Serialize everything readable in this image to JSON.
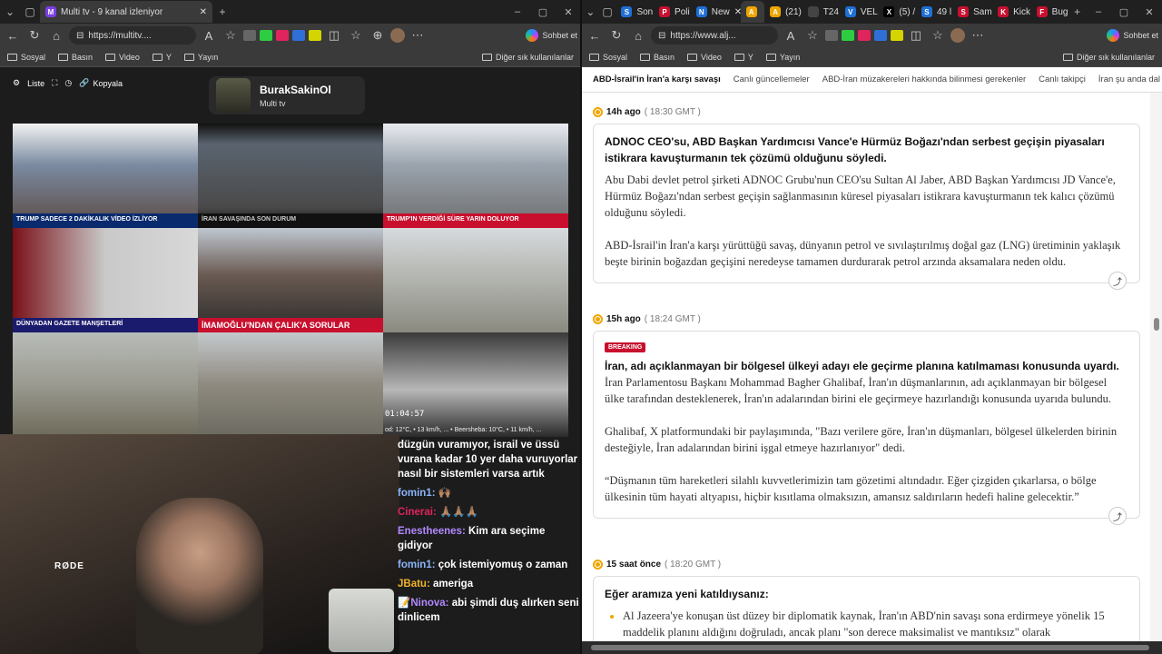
{
  "left": {
    "tab_title": "Multi tv - 9 kanal izleniyor",
    "url": "https://multitv....",
    "chat_button": "Sohbet et",
    "bookmarks": [
      "Sosyal",
      "Basın",
      "Video",
      "Y",
      "Yayın"
    ],
    "bookmarks_other": "Diğer sık kullanılanlar",
    "toolbar": {
      "list": "Liste",
      "copy": "Kopyala"
    },
    "channel": {
      "name": "BurakSakinOl",
      "subtitle": "Multi tv"
    },
    "tiles": [
      {
        "ticker": "TRUMP SADECE 2 DAKİKALIK VİDEO İZLİYOR"
      },
      {
        "ticker": "İRAN SAVAŞINDA SON DURUM"
      },
      {
        "ticker": "TRUMP'IN VERDİĞİ SÜRE YARIN DOLUYOR"
      },
      {
        "ticker": "DÜNYADAN GAZETE MANŞETLERİ"
      },
      {
        "ticker": "İMAMOĞLU'NDAN ÇALIK'A SORULAR"
      },
      {
        "ticker": ""
      },
      {
        "ticker": ""
      },
      {
        "ticker": ""
      },
      {
        "ticker": "",
        "clock": "01:04:57",
        "weather": "od: 12°C, • 13 km/h, ... • Beersheba: 10°C, • 11 km/h, ..."
      }
    ],
    "cam_label": "RØDE",
    "chat": [
      {
        "user": "",
        "text": "düzgün vuramıyor, israil ve üssü vurana kadar 10 yer daha vuruyorlar nasıl bir sistemleri varsa artık",
        "color": "#ffffff"
      },
      {
        "user": "fomin1:",
        "text": "🙌🏽",
        "color": "#8ab4f8"
      },
      {
        "user": "Cinerai:",
        "text": "🙏🏽🙏🏽🙏🏽",
        "color": "#e0245e"
      },
      {
        "user": "Enestheenes:",
        "text": "Kim ara seçime gidiyor",
        "color": "#b388ff"
      },
      {
        "user": "fomin1:",
        "text": "çok istemiyomuş o zaman",
        "color": "#8ab4f8"
      },
      {
        "user": "JBatu:",
        "text": "ameriga",
        "color": "#f0b429"
      },
      {
        "user": "📝Ninova:",
        "text": "abi şimdi duş alırken seni dinlicem",
        "color": "#b388ff"
      }
    ]
  },
  "right": {
    "tabs": [
      "Son",
      "Poli",
      "New",
      "",
      "(21)",
      "T24",
      "VEL",
      "",
      "(5) /",
      "49 l",
      "Sam",
      "Kick",
      "Bug"
    ],
    "url": "https://www.alj...",
    "chat_button": "Sohbet et",
    "bookmarks": [
      "Sosyal",
      "Basın",
      "Video",
      "Y",
      "Yayın"
    ],
    "bookmarks_other": "Diğer sık kullanılanlar",
    "subnav": [
      "ABD-İsrail'in İran'a karşı savaşı",
      "Canlı güncellemeler",
      "ABD-İran müzakereleri hakkında bilinmesi gerekenler",
      "Canlı takipçi",
      "İran şu anda dal"
    ],
    "entries": [
      {
        "time": "14h ago",
        "gmt": "( 18:30 GMT )",
        "breaking": "",
        "headline": "ADNOC CEO'su, ABD Başkan Yardımcısı Vance'e Hürmüz Boğazı'ndan serbest geçişin piyasaları istikrara kavuşturmanın tek çözümü olduğunu söyledi.",
        "paragraphs": [
          "Abu Dabi devlet petrol şirketi ADNOC Grubu'nun CEO'su Sultan Al Jaber, ABD Başkan Yardımcısı JD Vance'e, Hürmüz Boğazı'ndan serbest geçişin sağlanmasının küresel piyasaları istikrara kavuşturmanın tek kalıcı çözümü olduğunu söyledi.",
          "ABD-İsrail'in İran'a karşı yürüttüğü savaş, dünyanın petrol ve sıvılaştırılmış doğal gaz (LNG) üretiminin yaklaşık beşte birinin boğazdan geçişini neredeyse tamamen durdurarak petrol arzında aksamalara neden oldu."
        ]
      },
      {
        "time": "15h ago",
        "gmt": "( 18:24 GMT )",
        "breaking": "BREAKING",
        "headline": "İran, adı açıklanmayan bir bölgesel ülkeyi adayı ele geçirme planına katılmaması konusunda uyardı.",
        "paragraphs": [
          "İran Parlamentosu Başkanı Mohammad Bagher Ghalibaf, İran'ın düşmanlarının, adı açıklanmayan bir bölgesel ülke tarafından desteklenerek, İran'ın adalarından birini ele geçirmeye hazırlandığı konusunda uyarıda bulundu.",
          "Ghalibaf, X platformundaki bir paylaşımında, \"Bazı verilere göre, İran'ın düşmanları, bölgesel ülkelerden birinin desteğiyle, İran adalarından birini işgal etmeye hazırlanıyor\" dedi.",
          "“Düşmanın tüm hareketleri silahlı kuvvetlerimizin tam gözetimi altındadır. Eğer çizgiden çıkarlarsa, o bölge ülkesinin tüm hayati altyapısı, hiçbir kısıtlama olmaksızın, amansız saldırıların hedefi haline gelecektir.”"
        ]
      },
      {
        "time": "15 saat önce",
        "gmt": "( 18:20 GMT )",
        "headline": "Eğer aramıza yeni katıldıysanız:",
        "bullet": "Al Jazeera'ye konuşan üst düzey bir diplomatik kaynak, İran'ın ABD'nin savaşı sona erdirmeye yönelik 15 maddelik planını aldığını doğruladı, ancak planı \"son derece maksimalist ve mantıksız\" olarak"
      }
    ]
  }
}
